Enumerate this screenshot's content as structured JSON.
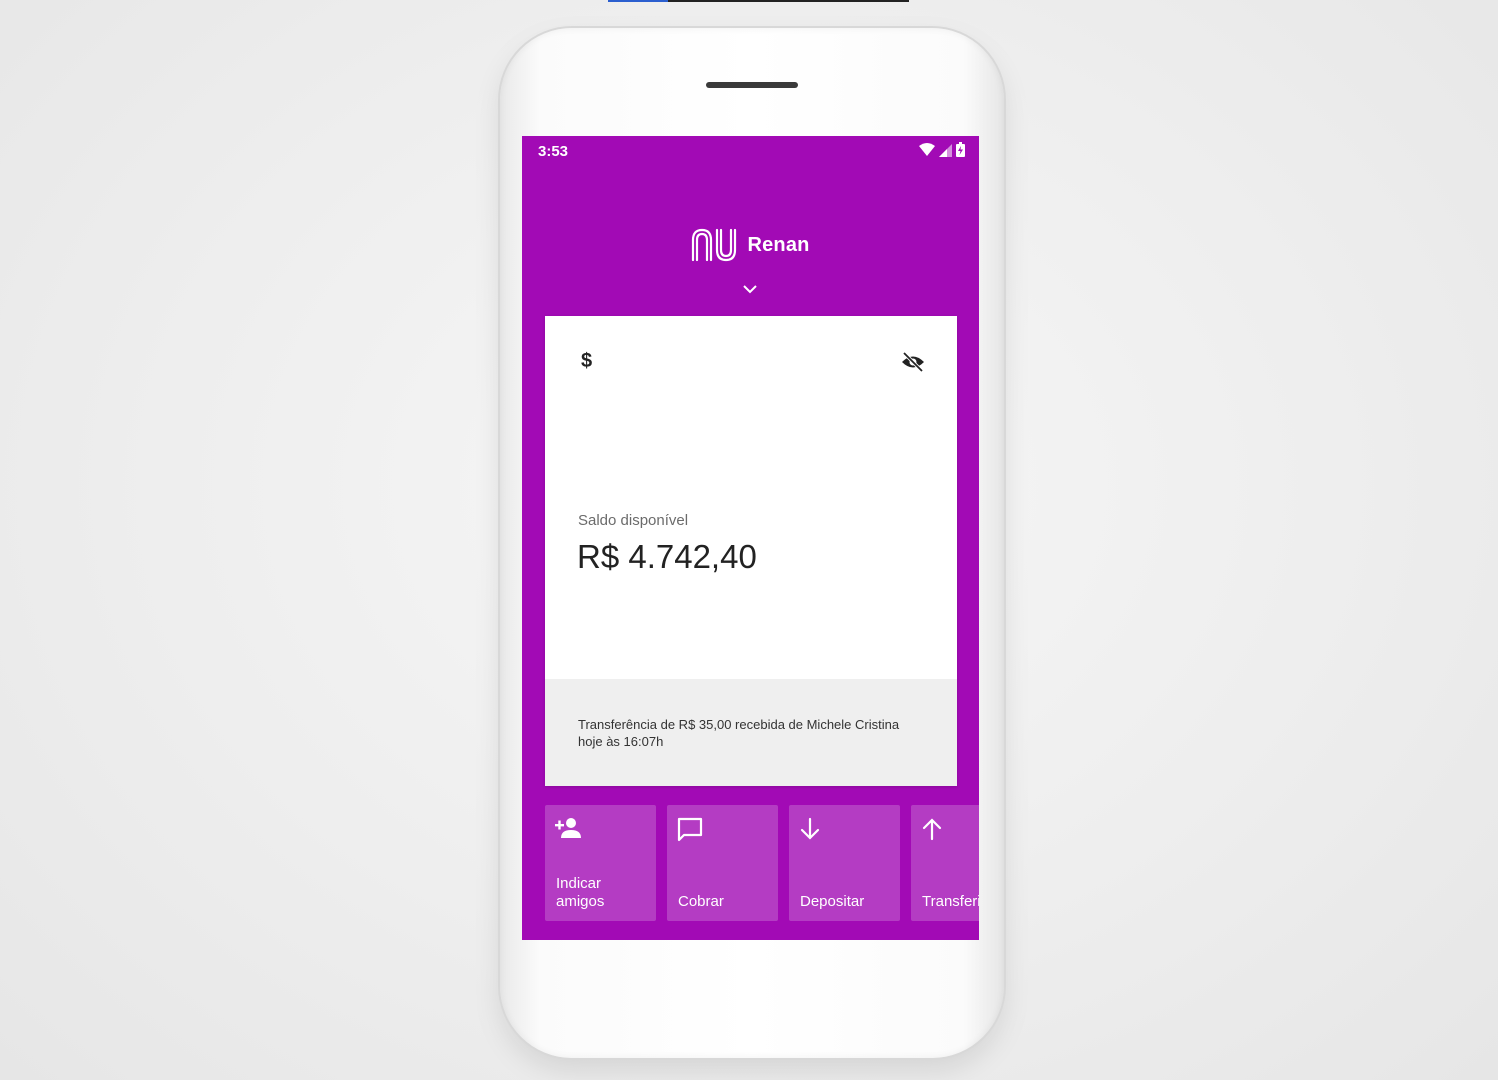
{
  "colors": {
    "brand_purple": "#a20ab5",
    "shortcut_purple": "#b43cc3",
    "top_bar_accent": "#2b5fcf"
  },
  "status_bar": {
    "time": "3:53",
    "icons": [
      "wifi-icon",
      "signal-icon",
      "battery-icon"
    ]
  },
  "header": {
    "logo_icon": "nu-logo",
    "user_name": "Renan",
    "chevron_icon": "chevron-down-icon"
  },
  "card": {
    "top_left_icon": "dollar-icon",
    "top_right_icon": "eye-off-icon",
    "balance_label": "Saldo disponível",
    "balance_value": "R$ 4.742,40",
    "notification_line1": "Transferência de R$ 35,00 recebida de Michele Cristina",
    "notification_line2": "hoje às 16:07h"
  },
  "shortcuts": [
    {
      "icon": "person-add-icon",
      "line1": "Indicar",
      "line2": "amigos"
    },
    {
      "icon": "chat-bubble-icon",
      "line1": "",
      "line2": "Cobrar"
    },
    {
      "icon": "arrow-down-icon",
      "line1": "",
      "line2": "Depositar"
    },
    {
      "icon": "arrow-up-icon",
      "line1": "",
      "line2": "Transferir"
    }
  ]
}
